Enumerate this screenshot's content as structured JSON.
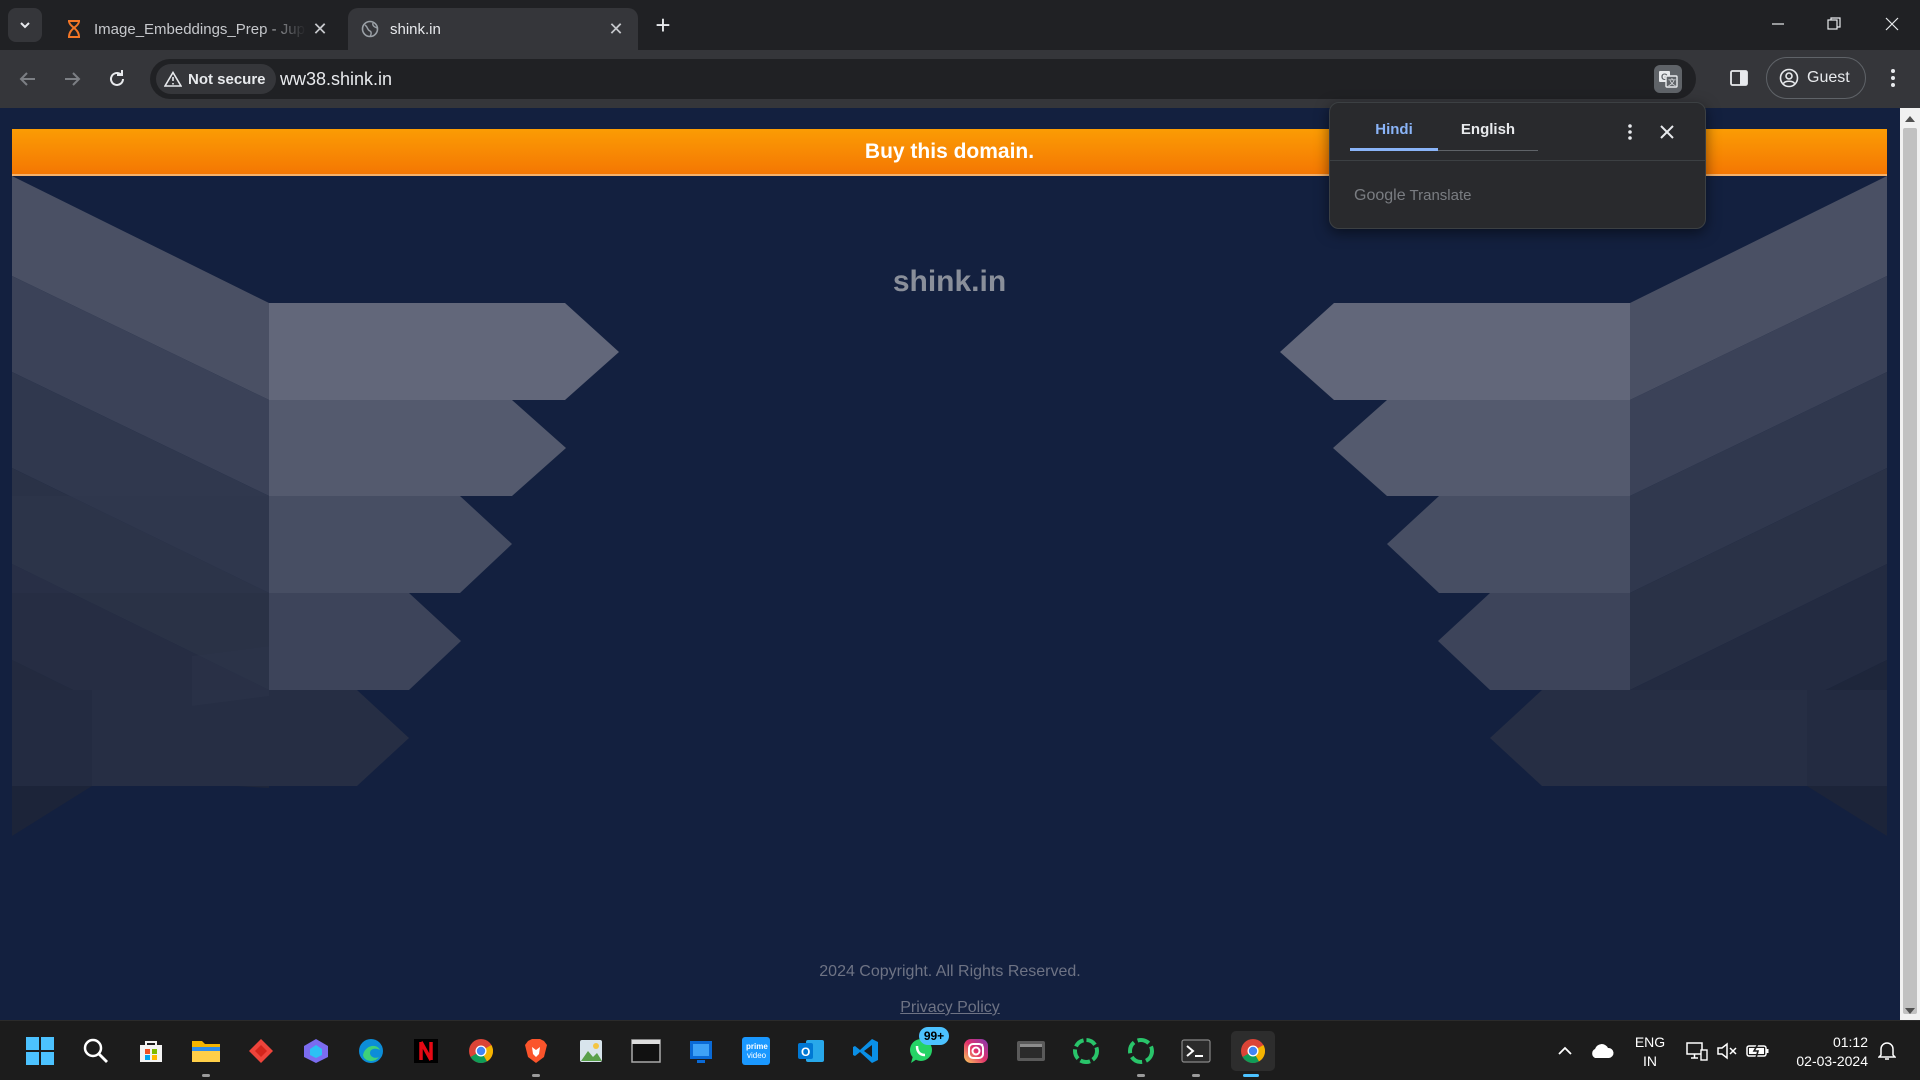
{
  "browser": {
    "tabs": [
      {
        "title": "Image_Embeddings_Prep - Jupyter",
        "favicon": "jupyter-hourglass-icon",
        "active": false
      },
      {
        "title": "shink.in",
        "favicon": "globe-icon",
        "active": true
      }
    ],
    "address": {
      "security_label": "Not secure",
      "url": "ww38.shink.in"
    },
    "profile_label": "Guest"
  },
  "translate_popup": {
    "languages": [
      "Hindi",
      "English"
    ],
    "selected": "Hindi",
    "brand": "Google",
    "product": "Translate"
  },
  "page": {
    "banner_text": "Buy this domain.",
    "domain_title": "shink.in",
    "copyright": "2024 Copyright. All Rights Reserved.",
    "privacy_link": "Privacy Policy",
    "colors": {
      "banner_orange": "#f47703",
      "background_navy": "#13203f"
    }
  },
  "taskbar": {
    "apps": [
      "start",
      "search",
      "store",
      "file-explorer",
      "anydesk",
      "copilot",
      "edge",
      "netflix",
      "chrome",
      "brave",
      "photos",
      "terminal-window",
      "windows-app",
      "prime-video",
      "outlook",
      "vscode",
      "whatsapp",
      "instagram",
      "media-player",
      "spinner-app",
      "spinner-app-2",
      "powershell",
      "chrome-active"
    ],
    "whatsapp_badge": "99+",
    "language": {
      "line1": "ENG",
      "line2": "IN"
    },
    "time": "01:12",
    "date": "02-03-2024"
  }
}
